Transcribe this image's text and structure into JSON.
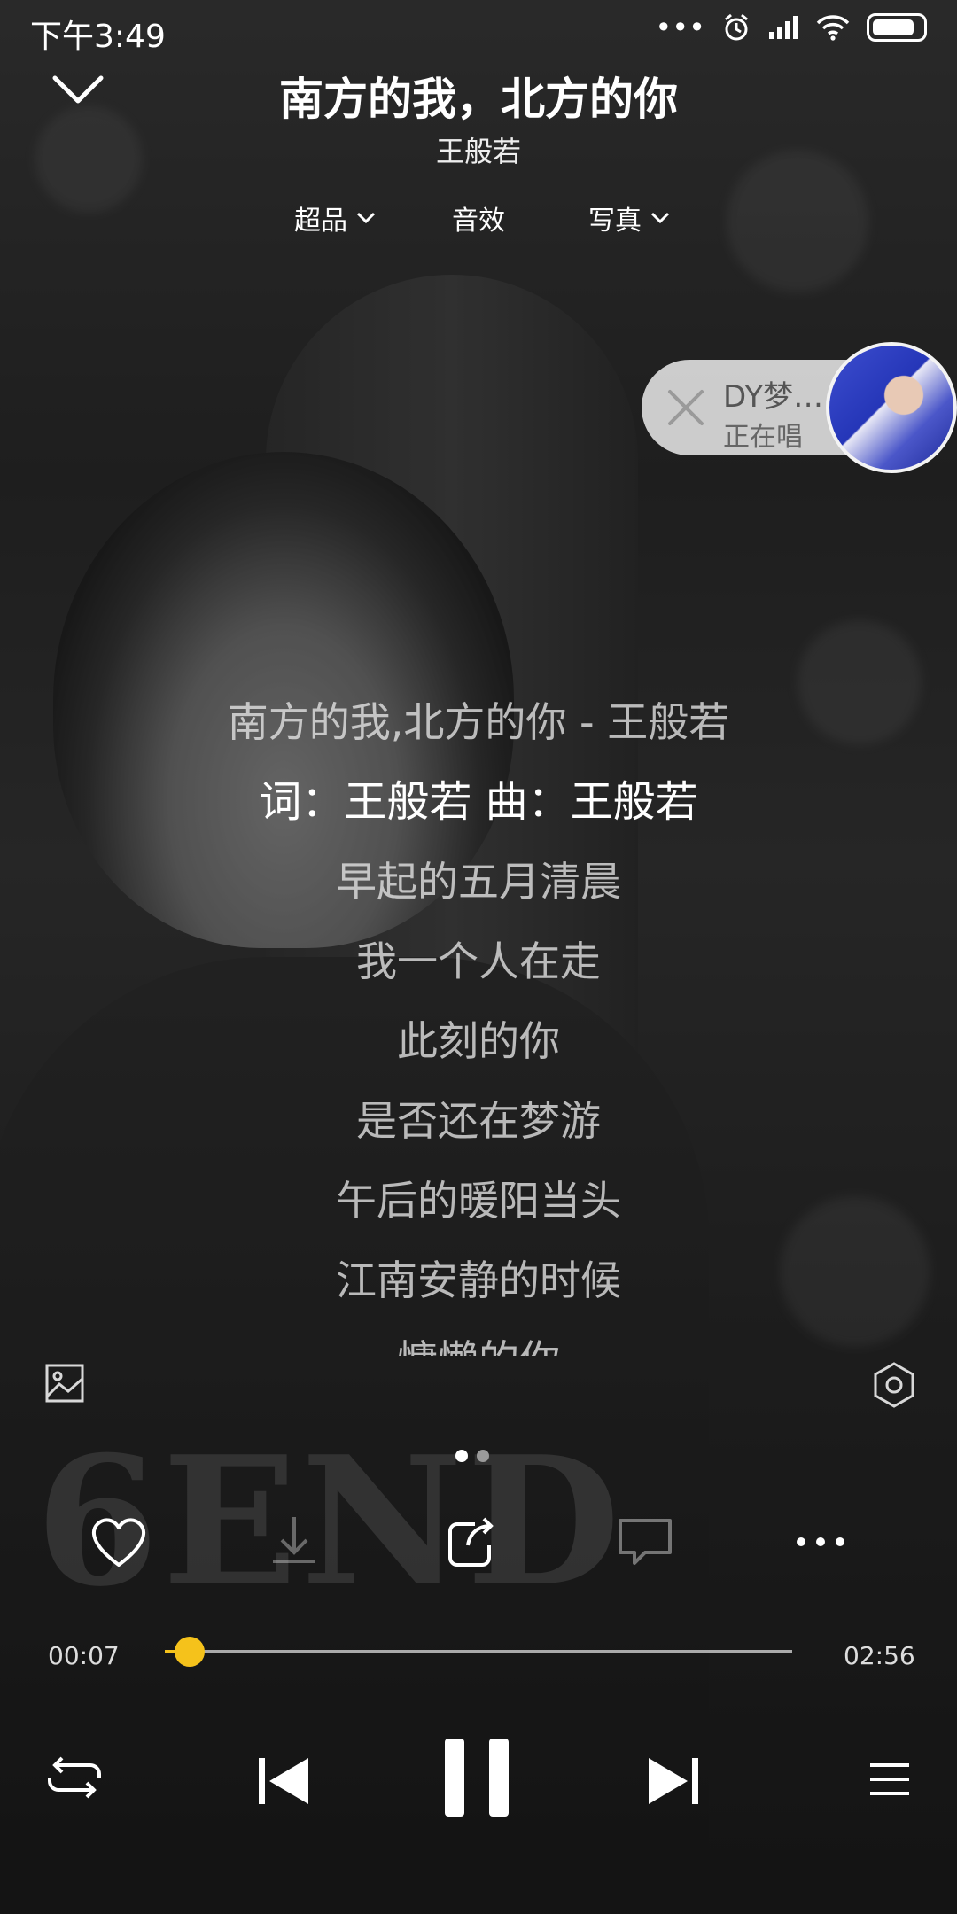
{
  "status_bar": {
    "time": "下午3:49",
    "signal_dots": "•••"
  },
  "header": {
    "title": "南方的我，北方的你",
    "artist": "王般若",
    "tabs": [
      {
        "label": "超品",
        "has_dropdown": true
      },
      {
        "label": "音效",
        "has_dropdown": false
      },
      {
        "label": "写真",
        "has_dropdown": true
      }
    ]
  },
  "floating_card": {
    "name": "DY梦…",
    "status": "正在唱"
  },
  "lyrics": [
    "南方的我,北方的你 - 王般若",
    "词：王般若 曲：王般若",
    "早起的五月清晨",
    "我一个人在走",
    "此刻的你",
    "是否还在梦游",
    "午后的暖阳当头",
    "江南安静的时候",
    "慵懒的你"
  ],
  "active_lyric_index": 1,
  "pager": {
    "pages": 2,
    "current": 0
  },
  "progress": {
    "elapsed": "00:07",
    "total": "02:56",
    "fraction": 0.04
  },
  "colors": {
    "accent": "#f5c21b"
  },
  "icons": {
    "back": "chevron-down-icon",
    "photo": "image-icon",
    "settings": "hexagon-settings-icon",
    "like": "heart-icon",
    "download": "download-icon",
    "share": "share-icon",
    "comment": "comment-icon",
    "more": "more-icon",
    "repeat": "repeat-icon",
    "prev": "previous-icon",
    "pause": "pause-icon",
    "next": "next-icon",
    "playlist": "playlist-icon"
  }
}
